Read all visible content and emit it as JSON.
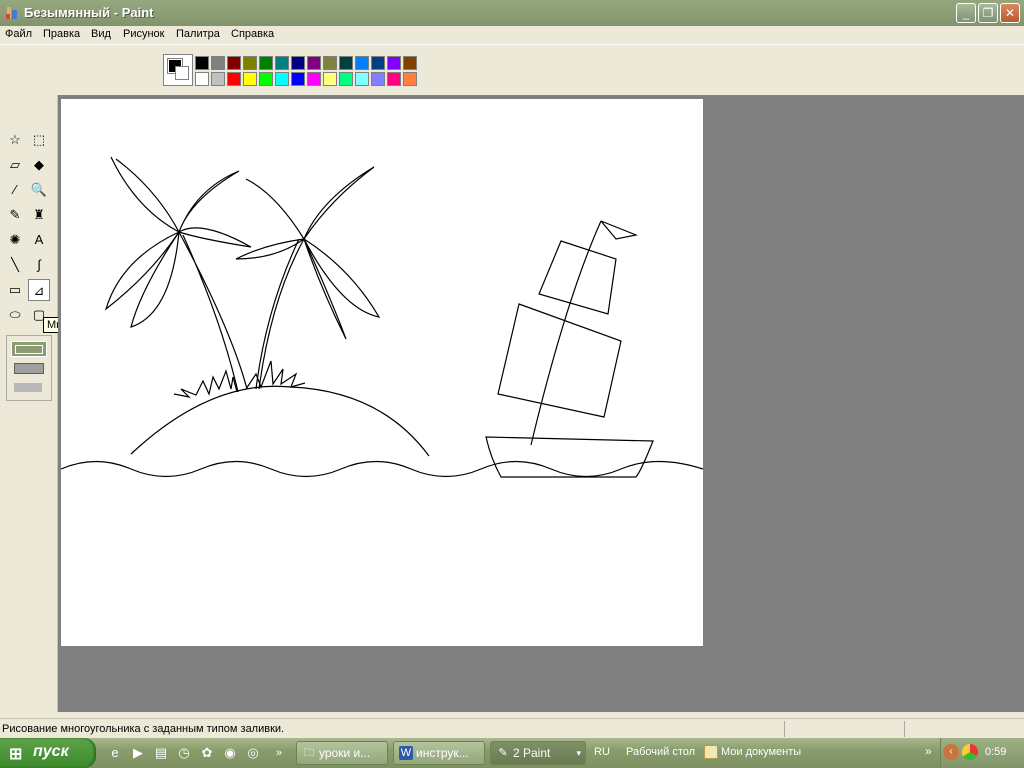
{
  "window": {
    "title": "Безымянный - Paint",
    "controls": {
      "minimize": "_",
      "maximize": "❐",
      "close": "✕"
    }
  },
  "menu": [
    "Файл",
    "Правка",
    "Вид",
    "Рисунок",
    "Палитра",
    "Справка"
  ],
  "palette": {
    "foreground": "#000000",
    "background": "#ffffff",
    "row1": [
      "#000000",
      "#808080",
      "#800000",
      "#808000",
      "#008000",
      "#008080",
      "#000080",
      "#800080",
      "#808040",
      "#004040",
      "#0080ff",
      "#004080",
      "#8000ff",
      "#804000"
    ],
    "row2": [
      "#ffffff",
      "#c0c0c0",
      "#ff0000",
      "#ffff00",
      "#00ff00",
      "#00ffff",
      "#0000ff",
      "#ff00ff",
      "#ffff80",
      "#00ff80",
      "#80ffff",
      "#8080ff",
      "#ff0080",
      "#ff8040"
    ]
  },
  "tools": [
    {
      "name": "free-select-icon",
      "glyph": "☆"
    },
    {
      "name": "rect-select-icon",
      "glyph": "⬚"
    },
    {
      "name": "eraser-icon",
      "glyph": "▱"
    },
    {
      "name": "fill-bucket-icon",
      "glyph": "◆"
    },
    {
      "name": "color-picker-icon",
      "glyph": "⁄"
    },
    {
      "name": "magnifier-icon",
      "glyph": "🔍"
    },
    {
      "name": "pencil-icon",
      "glyph": "✎"
    },
    {
      "name": "brush-icon",
      "glyph": "♜"
    },
    {
      "name": "airbrush-icon",
      "glyph": "✺"
    },
    {
      "name": "text-icon",
      "glyph": "A"
    },
    {
      "name": "line-icon",
      "glyph": "╲"
    },
    {
      "name": "curve-icon",
      "glyph": "∫"
    },
    {
      "name": "rectangle-icon",
      "glyph": "▭"
    },
    {
      "name": "polygon-icon",
      "glyph": "⊿"
    },
    {
      "name": "ellipse-icon",
      "glyph": "⬭"
    },
    {
      "name": "rounded-rect-icon",
      "glyph": "▢"
    }
  ],
  "tooltip": "Многоугольник",
  "status": "Рисование многоугольника с заданным типом заливки.",
  "taskbar": {
    "start": "пуск",
    "tasks": [
      {
        "label": "уроки и...",
        "icon": "folder-icon",
        "glyph": "🗀"
      },
      {
        "label": "инструк...",
        "icon": "word-icon",
        "glyph": "W"
      },
      {
        "label": "2 Paint",
        "icon": "paint-icon",
        "glyph": "✎"
      }
    ],
    "language": "RU",
    "desktop_label": "Рабочий стол",
    "my_docs_label": "Мои документы",
    "clock": "0:59"
  }
}
